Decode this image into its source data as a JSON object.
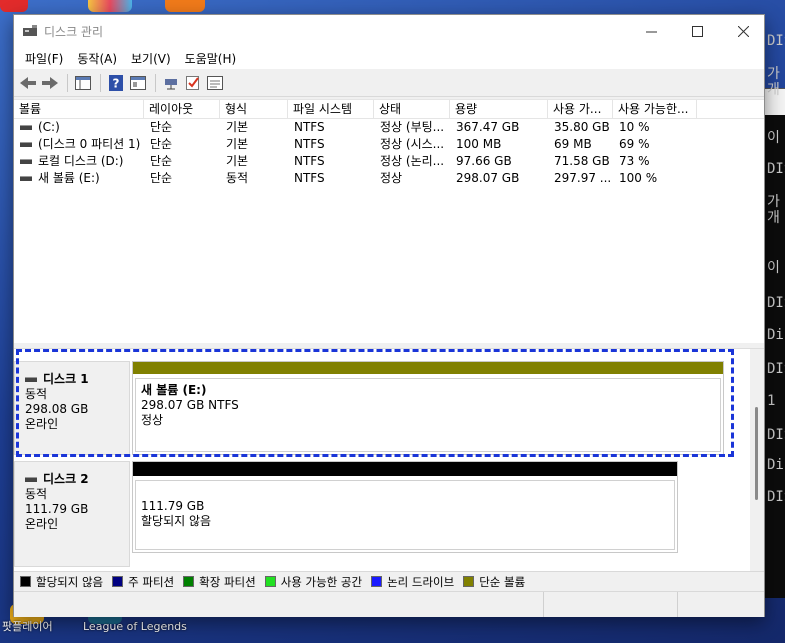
{
  "window": {
    "title": "디스크 관리",
    "controls": [
      "minimize-icon",
      "maximize-icon",
      "close-icon"
    ]
  },
  "menu": [
    "파일(F)",
    "동작(A)",
    "보기(V)",
    "도움말(H)"
  ],
  "toolbar_icons": [
    "back-icon",
    "forward-icon",
    "console-view-icon",
    "help-icon",
    "properties-icon",
    "connect-icon",
    "check-icon",
    "list-icon"
  ],
  "volume_table": {
    "columns": [
      "볼륨",
      "레이아웃",
      "형식",
      "파일 시스템",
      "상태",
      "용량",
      "사용 가...",
      "사용 가능한..."
    ],
    "rows": [
      [
        "(C:)",
        "단순",
        "기본",
        "NTFS",
        "정상 (부팅...",
        "367.47 GB",
        "35.80 GB",
        "10 %"
      ],
      [
        "(디스크 0 파티션 1)",
        "단순",
        "기본",
        "NTFS",
        "정상 (시스...",
        "100 MB",
        "69 MB",
        "69 %"
      ],
      [
        "로컬 디스크 (D:)",
        "단순",
        "기본",
        "NTFS",
        "정상 (논리...",
        "97.66 GB",
        "71.58 GB",
        "73 %"
      ],
      [
        "새 볼륨 (E:)",
        "단순",
        "동적",
        "NTFS",
        "정상",
        "298.07 GB",
        "297.97 ...",
        "100 %"
      ]
    ]
  },
  "disks": [
    {
      "name": "디스크 1",
      "type": "동적",
      "size": "298.08 GB",
      "status": "온라인",
      "partition": {
        "title": "새 볼륨  (E:)",
        "detail": "298.07 GB NTFS",
        "state": "정상",
        "color": "#808000"
      }
    },
    {
      "name": "디스크 2",
      "type": "동적",
      "size": "111.79 GB",
      "status": "온라인",
      "partition": {
        "title": "",
        "detail": "111.79 GB",
        "state": "할당되지 않음",
        "color": "#000000"
      }
    }
  ],
  "legend": [
    {
      "label": "할당되지 않음",
      "color": "#000000"
    },
    {
      "label": "주 파티션",
      "color": "#000080"
    },
    {
      "label": "확장 파티션",
      "color": "#008000"
    },
    {
      "label": "사용 가능한 공간",
      "color": "#22e022"
    },
    {
      "label": "논리 드라이브",
      "color": "#1a1aff"
    },
    {
      "label": "단순 볼륨",
      "color": "#808000"
    }
  ],
  "desktop": {
    "icon_labels": [
      "팟플레이어",
      "League of Legends"
    ]
  },
  "console_lines": [
    "DIS",
    "가",
    "개",
    "이",
    "DIS",
    "가",
    "개",
    "이",
    "DIS",
    "Dis",
    "DIS",
    "1",
    "DIS",
    "Dis",
    "DIS"
  ],
  "accent_highlight": "#1a35d8"
}
